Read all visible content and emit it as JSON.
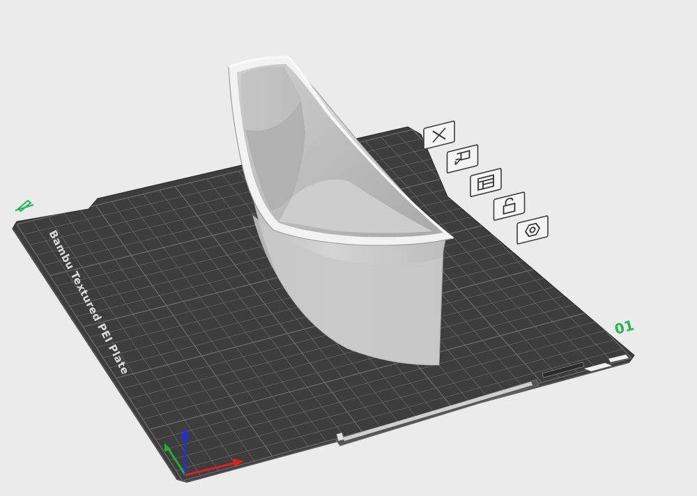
{
  "plate": {
    "label": "Bambu Textured PEI Plate",
    "number": "01",
    "edit_icon": "pencil-icon",
    "grid_color": "#6b6b6b",
    "bed_color": "#3d3d3d",
    "accent_color": "#1db954"
  },
  "plate_toolbar": {
    "buttons": [
      {
        "name": "delete-plate-button",
        "icon": "close-icon"
      },
      {
        "name": "auto-arrange-button",
        "icon": "auto-arrange-icon"
      },
      {
        "name": "plate-settings-button",
        "icon": "plate-layout-icon"
      },
      {
        "name": "lock-plate-button",
        "icon": "unlock-icon"
      },
      {
        "name": "plate-options-button",
        "icon": "gear-icon"
      }
    ]
  },
  "axes": {
    "x_color": "#e02020",
    "y_color": "#20b030",
    "z_color": "#2030e0"
  },
  "model": {
    "shape": "half-cylinder-shell",
    "color": "#c8c8c8"
  }
}
